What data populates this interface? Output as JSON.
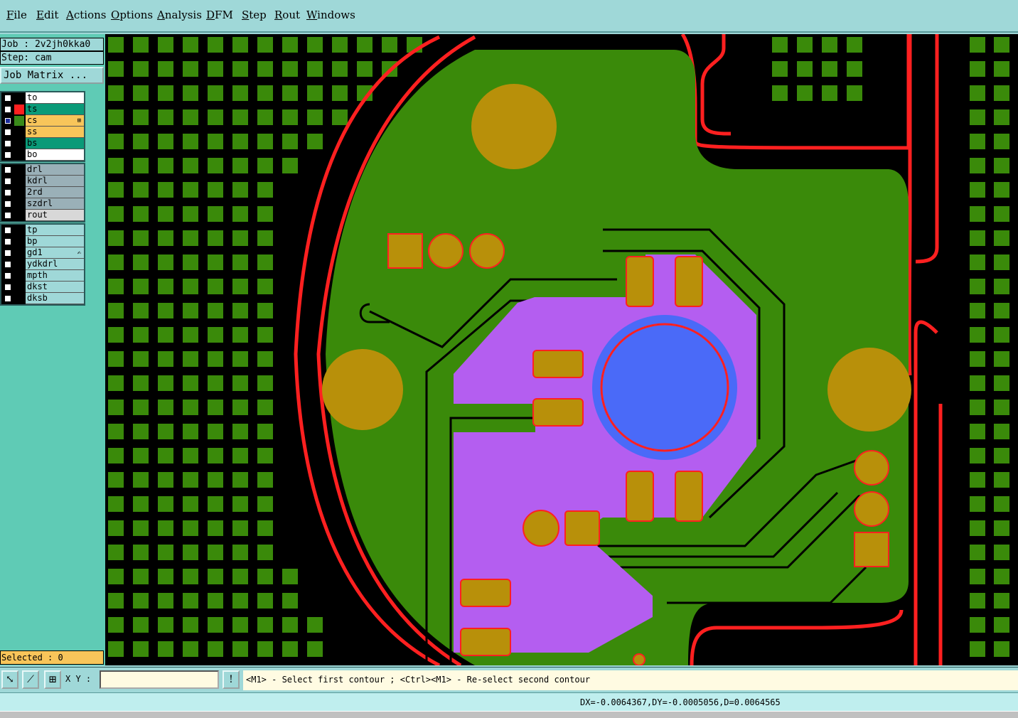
{
  "menu": [
    "File",
    "Edit",
    "Actions",
    "Options",
    "Analysis",
    "DFM",
    "Step",
    "Rout",
    "Windows"
  ],
  "job": {
    "job_label": "Job : 2v2jh0kka0",
    "step_label": "Step: cam",
    "matrix_button": "Job Matrix ..."
  },
  "layers": {
    "group1": [
      {
        "name": "to",
        "color": "#ffffff",
        "swatch": "#000000",
        "checked": false,
        "marker": ""
      },
      {
        "name": "ts",
        "color": "#0a9a78",
        "swatch": "#ff2020",
        "checked": false,
        "marker": ""
      },
      {
        "name": "cs",
        "color": "#f8c55a",
        "swatch": "#3a8a1a",
        "checked": true,
        "marker": "⊞"
      },
      {
        "name": "ss",
        "color": "#f8c55a",
        "swatch": "#000000",
        "checked": false,
        "marker": ""
      },
      {
        "name": "bs",
        "color": "#0a9a78",
        "swatch": "#000000",
        "checked": false,
        "marker": ""
      },
      {
        "name": "bo",
        "color": "#ffffff",
        "swatch": "#000000",
        "checked": false,
        "marker": ""
      }
    ],
    "group2": [
      {
        "name": "drl",
        "color": "#9ab0b8",
        "swatch": "#000000",
        "checked": false,
        "marker": ""
      },
      {
        "name": "kdrl",
        "color": "#9ab0b8",
        "swatch": "#000000",
        "checked": false,
        "marker": ""
      },
      {
        "name": "2rd",
        "color": "#9ab0b8",
        "swatch": "#000000",
        "checked": false,
        "marker": ""
      },
      {
        "name": "szdrl",
        "color": "#9ab0b8",
        "swatch": "#000000",
        "checked": false,
        "marker": ""
      },
      {
        "name": "rout",
        "color": "#d8d8d8",
        "swatch": "#000000",
        "checked": false,
        "marker": ""
      }
    ],
    "group3": [
      {
        "name": "tp",
        "color": "#9fd8d8",
        "swatch": "#000000",
        "checked": false,
        "marker": ""
      },
      {
        "name": "bp",
        "color": "#9fd8d8",
        "swatch": "#000000",
        "checked": false,
        "marker": ""
      },
      {
        "name": "gd1",
        "color": "#9fd8d8",
        "swatch": "#000000",
        "checked": false,
        "marker": "✍"
      },
      {
        "name": "ydkdrl",
        "color": "#9fd8d8",
        "swatch": "#000000",
        "checked": false,
        "marker": ""
      },
      {
        "name": "mpth",
        "color": "#9fd8d8",
        "swatch": "#000000",
        "checked": false,
        "marker": ""
      },
      {
        "name": "dkst",
        "color": "#9fd8d8",
        "swatch": "#000000",
        "checked": false,
        "marker": ""
      },
      {
        "name": "dksb",
        "color": "#9fd8d8",
        "swatch": "#000000",
        "checked": false,
        "marker": ""
      }
    ]
  },
  "selected": "Selected : 0",
  "toolbar": {
    "xy_label": "X Y :",
    "xy_value": "",
    "alert_icon": "!"
  },
  "prompt": "<M1> - Select first contour ; <Ctrl><M1> - Re-select second contour",
  "status": "DX=-0.0064367,DY=-0.0005056,D=0.0064565",
  "colors": {
    "copper": "#3a8a0a",
    "pad": "#b8900a",
    "outline": "#ff2020",
    "mask": "#b45ef0",
    "via": "#4a6af8"
  }
}
